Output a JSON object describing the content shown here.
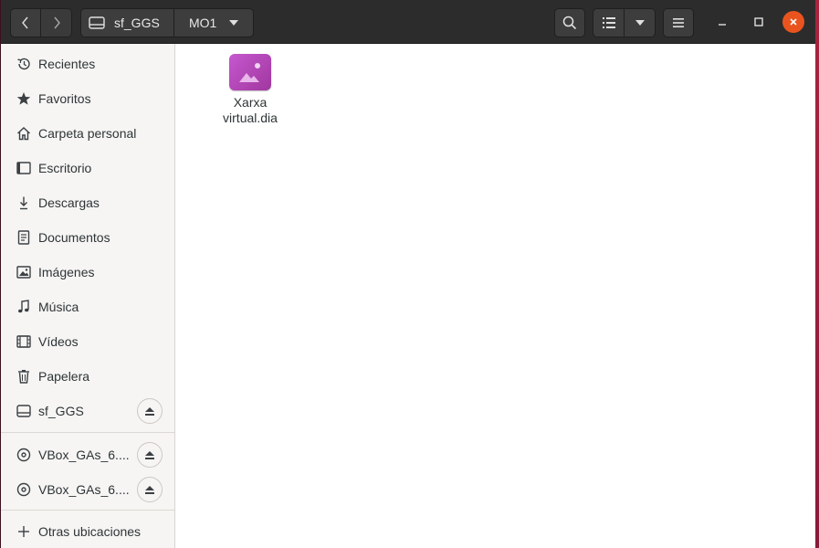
{
  "header": {
    "path": [
      "sf_GGS",
      "MO1"
    ]
  },
  "sidebar": {
    "items": [
      {
        "label": "Recientes",
        "icon": "recent-icon"
      },
      {
        "label": "Favoritos",
        "icon": "star-icon"
      },
      {
        "label": "Carpeta personal",
        "icon": "home-icon"
      },
      {
        "label": "Escritorio",
        "icon": "desktop-icon"
      },
      {
        "label": "Descargas",
        "icon": "download-icon"
      },
      {
        "label": "Documentos",
        "icon": "document-icon"
      },
      {
        "label": "Imágenes",
        "icon": "image-icon"
      },
      {
        "label": "Música",
        "icon": "music-icon"
      },
      {
        "label": "Vídeos",
        "icon": "video-icon"
      },
      {
        "label": "Papelera",
        "icon": "trash-icon"
      },
      {
        "label": "sf_GGS",
        "icon": "drive-icon"
      }
    ],
    "devices": [
      {
        "label": "VBox_GAs_6....",
        "icon": "disc-icon"
      },
      {
        "label": "VBox_GAs_6....",
        "icon": "disc-icon"
      }
    ],
    "other": {
      "label": "Otras ubicaciones",
      "icon": "plus-icon"
    }
  },
  "content": {
    "files": [
      {
        "name": "Xarxa virtual.dia",
        "icon": "image-file-icon"
      }
    ]
  },
  "colors": {
    "headerbar": "#2c2c2c",
    "close_button": "#e9541e",
    "file_icon": "#b84bc0"
  }
}
